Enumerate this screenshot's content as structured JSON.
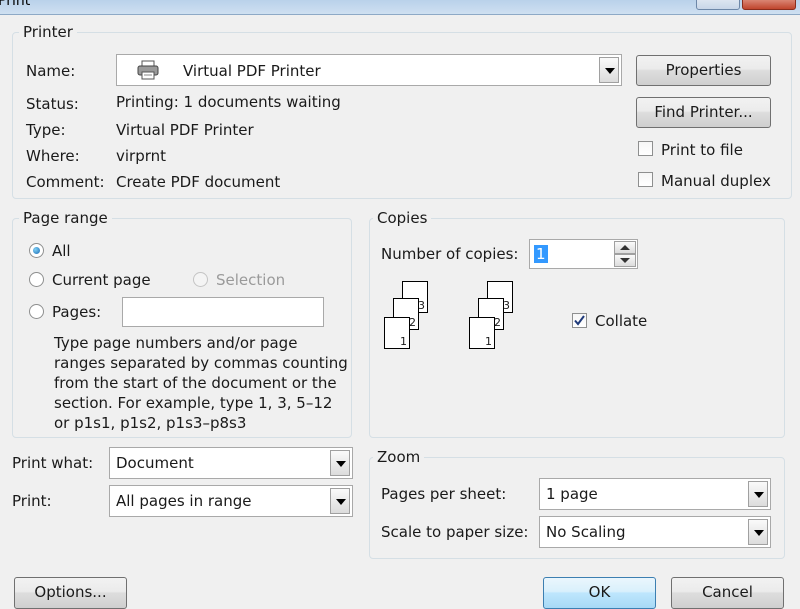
{
  "window": {
    "title": "Print"
  },
  "printer": {
    "group_label": "Printer",
    "name_label": "Name:",
    "name_value": "Virtual PDF Printer",
    "status_label": "Status:",
    "status_value": "Printing: 1 documents waiting",
    "type_label": "Type:",
    "type_value": "Virtual PDF Printer",
    "where_label": "Where:",
    "where_value": "virprnt",
    "comment_label": "Comment:",
    "comment_value": "Create PDF document",
    "properties_button": "Properties",
    "find_printer_button": "Find Printer...",
    "print_to_file_label": "Print to file",
    "print_to_file_checked": false,
    "manual_duplex_label": "Manual duplex",
    "manual_duplex_checked": false
  },
  "page_range": {
    "group_label": "Page range",
    "all_label": "All",
    "current_page_label": "Current page",
    "selection_label": "Selection",
    "pages_label": "Pages:",
    "pages_value": "",
    "selected": "All",
    "help_text_lines": [
      "Type page numbers and/or page",
      "ranges separated by commas counting",
      "from the start of the document or the",
      "section. For example, type 1, 3, 5–12",
      "or p1s1, p1s2, p1s3–p8s3"
    ]
  },
  "copies": {
    "group_label": "Copies",
    "number_label": "Number of copies:",
    "number_value": "1",
    "collate_label": "Collate",
    "collate_checked": true,
    "page_numbers": [
      "1",
      "2",
      "3"
    ]
  },
  "print_what": {
    "label": "Print what:",
    "value": "Document"
  },
  "print": {
    "label": "Print:",
    "value": "All pages in range"
  },
  "zoom": {
    "group_label": "Zoom",
    "pages_per_sheet_label": "Pages per sheet:",
    "pages_per_sheet_value": "1 page",
    "scale_label": "Scale to paper size:",
    "scale_value": "No Scaling"
  },
  "footer": {
    "options_button": "Options...",
    "ok_button": "OK",
    "cancel_button": "Cancel"
  }
}
